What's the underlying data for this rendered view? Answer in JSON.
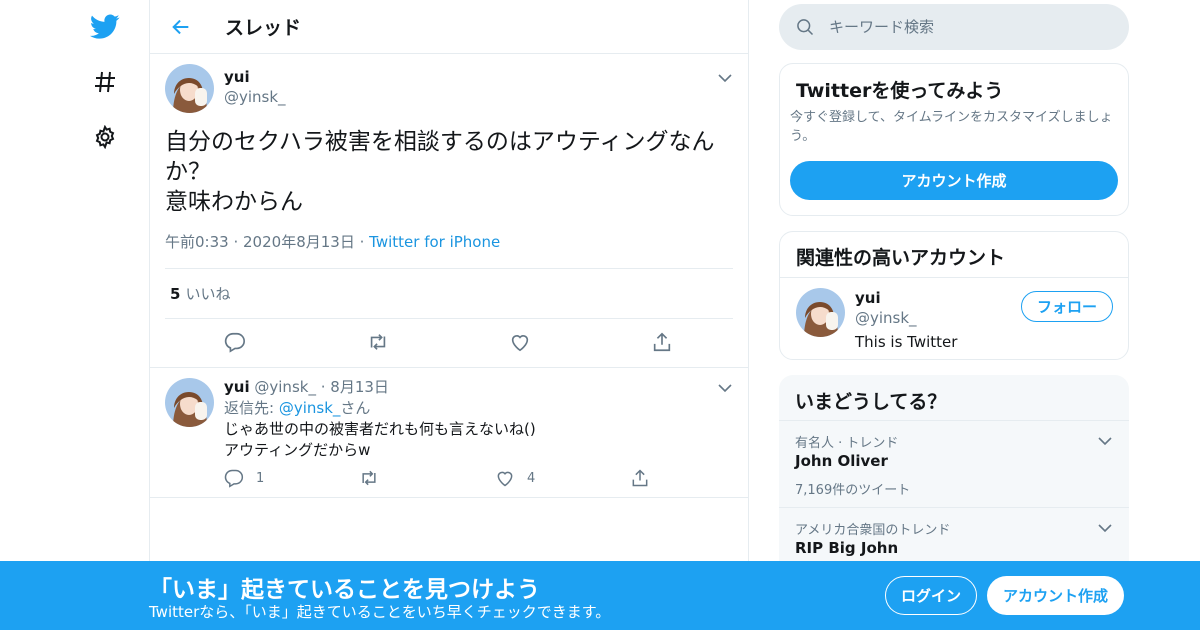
{
  "header": {
    "title": "スレッド"
  },
  "main_tweet": {
    "name": "yui",
    "handle": "@yinsk_",
    "text": "自分のセクハラ被害を相談するのはアウティングなんか？\n意味わからん",
    "time": "午前0:33",
    "date": "2020年8月13日",
    "source": "Twitter for iPhone",
    "like_count": "5",
    "like_label": "いいね"
  },
  "reply_tweet": {
    "name": "yui",
    "handle": "@yinsk_",
    "date": "8月13日",
    "reply_prefix": "返信先: ",
    "reply_to": "@yinsk_",
    "reply_suffix": "さん",
    "line1": "じゃあ世の中の被害者だれも何も言えないね()",
    "line2": "アウティングだからw",
    "reply_count": "1",
    "like_count": "4"
  },
  "search": {
    "placeholder": "キーワード検索"
  },
  "signup_card": {
    "title": "Twitterを使ってみよう",
    "desc": "今すぐ登録して、タイムラインをカスタマイズしましょう。",
    "button": "アカウント作成"
  },
  "related_card": {
    "title": "関連性の高いアカウント",
    "name": "yui",
    "handle": "@yinsk_",
    "bio": "This is Twitter",
    "follow": "フォロー"
  },
  "trends": {
    "title": "いまどうしてる？",
    "items": [
      {
        "context": "有名人 · トレンド",
        "name": "John Oliver",
        "count": "7,169件のツイート"
      },
      {
        "context": "アメリカ合衆国のトレンド",
        "name": "RIP Big John"
      }
    ]
  },
  "bottom_bar": {
    "title": "「いま」起きていることを見つけよう",
    "subtitle": "Twitterなら、「いま」起きていることをいち早くチェックできます。",
    "login": "ログイン",
    "signup": "アカウント作成"
  },
  "colors": {
    "accent": "#1da1f2",
    "link": "#1b95e0",
    "muted": "#657786",
    "border": "#e6ecf0"
  }
}
